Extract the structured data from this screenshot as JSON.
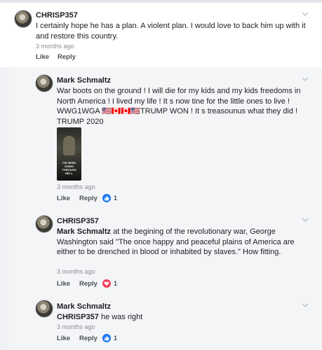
{
  "comments": [
    {
      "author": "CHRISP357",
      "text": "I certainly hope he has a plan. A violent plan. I would love to back him up with it and restore this country.",
      "time": "3 months ago",
      "like_label": "Like",
      "reply_label": "Reply"
    },
    {
      "author": "Mark Schmaltz",
      "text": "War boots on the ground ! I will die for my kids and my kids freedoms in North America ! I lived my life ! It s now tine for the  little ones to live ! WWG1WGA 🇺🇸🇨🇦🇨🇦🇺🇸TRUMP WON ! It s treasounus what they did ! TRUMP 2020",
      "image_caption": "I'VE BEEN GOING THROUGH HELL.",
      "time": "3 months ago",
      "like_label": "Like",
      "reply_label": "Reply",
      "reaction": "like-icon",
      "reaction_count": "1"
    },
    {
      "author": "CHRISP357",
      "mention": "Mark Schmaltz",
      "text": " at the begining of the revolutionary war, George Washington said \"The once happy and peaceful plains of America are either to be drenched in blood or inhabited by slaves.\" How fitting.",
      "time": "3 months ago",
      "like_label": "Like",
      "reply_label": "Reply",
      "reaction": "love-icon",
      "reaction_count": "1"
    },
    {
      "author": "Mark Schmaltz",
      "mention": "CHRISP357",
      "text": " he was right",
      "time": "3 months ago",
      "like_label": "Like",
      "reply_label": "Reply",
      "reaction": "like-icon",
      "reaction_count": "1"
    }
  ],
  "colors": {
    "like": "#1877f2",
    "love": "#f33e58",
    "muted": "#8a8d91"
  }
}
